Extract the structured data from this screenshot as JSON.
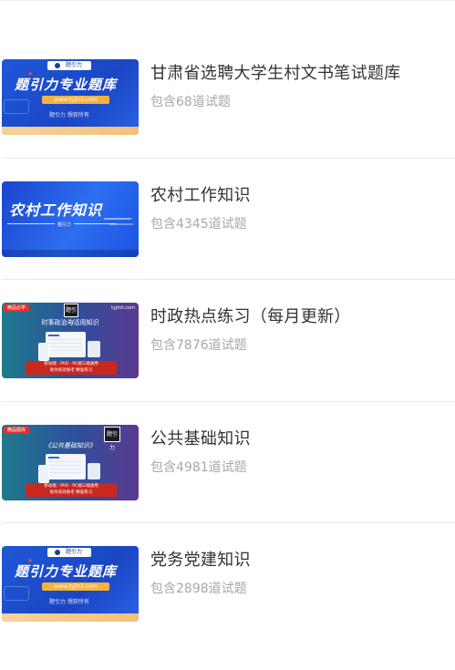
{
  "items": [
    {
      "title": "甘肃省选聘大学生村文书笔试题库",
      "count": "包含68道试题",
      "thumb": {
        "kind": "banner",
        "logo_text": "题引力",
        "headline": "题引力专业题库",
        "url": "www.tyjlnli.com",
        "slogan": "题引力 想获所有"
      }
    },
    {
      "title": "农村工作知识",
      "count": "包含4345道试题",
      "thumb": {
        "kind": "rural",
        "headline": "农村工作知识",
        "sub": "题引力"
      }
    },
    {
      "title": "时政热点练习（每月更新）",
      "count": "包含7876道试题",
      "thumb": {
        "kind": "course",
        "tag": "精品必学",
        "logo_text": "题引力",
        "url": "tyjinli.com",
        "headline": "时事政治与活用知识",
        "banner_line1": "移动端 · PAD · PC端三端通用",
        "banner_line2": "助你高效备考 精准练习"
      }
    },
    {
      "title": "公共基础知识",
      "count": "包含4981道试题",
      "thumb": {
        "kind": "course",
        "tag": "精品题库",
        "logo_text": "题引力",
        "headline": "《公共基础知识》",
        "banner_line1": "移动端 · PAD · PC端三端通用",
        "banner_line2": "助你高效备考 精准练习"
      }
    },
    {
      "title": "党务党建知识",
      "count": "包含2898道试题",
      "thumb": {
        "kind": "banner",
        "logo_text": "题引力",
        "headline": "题引力专业题库",
        "url": "www.tyjlnli.com",
        "slogan": "题引力 想获所有"
      }
    }
  ]
}
